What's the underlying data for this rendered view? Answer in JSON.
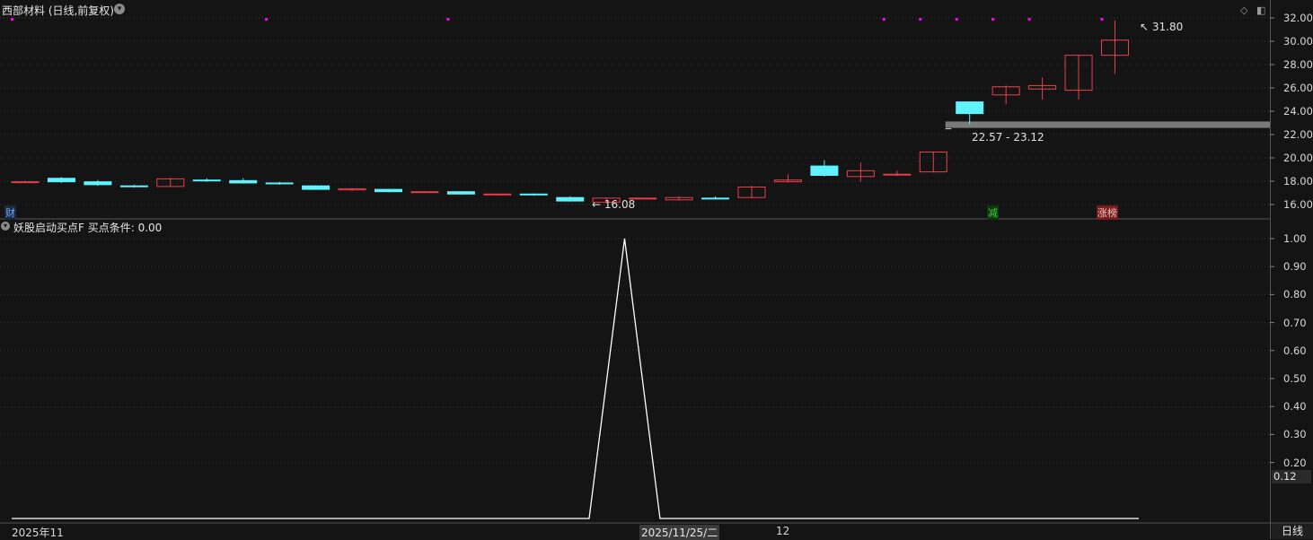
{
  "header": {
    "title": "西部材料 (日线,前复权)",
    "indicator_title": "妖股启动买点F  买点条件: 0.00"
  },
  "colors": {
    "background": "#141414",
    "up": "#e8404b",
    "down": "#5ef3ff",
    "marker": "#ff00ff",
    "indicator_line": "#ffffff",
    "grid": "#3a3a3a",
    "support_band": "#7a7a7a"
  },
  "price_axis": {
    "ticks": [
      "32.00",
      "30.00",
      "28.00",
      "26.00",
      "24.00",
      "22.00",
      "20.00",
      "18.00",
      "16.00"
    ]
  },
  "indicator_axis": {
    "ticks": [
      "1.00",
      "0.90",
      "0.80",
      "0.70",
      "0.60",
      "0.50",
      "0.40",
      "0.30",
      "0.20"
    ],
    "current_value": "0.12"
  },
  "time_axis": {
    "start_label": "2025年11",
    "cursor_label": "2025/11/25/二",
    "month_label": "12"
  },
  "bottom_right": {
    "period_label": "日线"
  },
  "tags": {
    "finance": "财",
    "reduce": "减",
    "limit_list": "涨榜"
  },
  "annotations": {
    "low_label": "16.08",
    "high_label": "31.80",
    "support_range": "22.57 - 23.12"
  },
  "chart_data": {
    "type": "candlestick",
    "price_range": [
      15.2,
      32.4
    ],
    "indicator_range": [
      0.0,
      1.0
    ],
    "candles": [
      {
        "o": 17.95,
        "h": 18.05,
        "l": 17.85,
        "c": 17.95
      },
      {
        "o": 18.25,
        "h": 18.35,
        "l": 17.85,
        "c": 17.95
      },
      {
        "o": 17.95,
        "h": 18.1,
        "l": 17.6,
        "c": 17.7
      },
      {
        "o": 17.6,
        "h": 17.7,
        "l": 17.45,
        "c": 17.55
      },
      {
        "o": 17.55,
        "h": 18.3,
        "l": 17.5,
        "c": 18.2
      },
      {
        "o": 18.1,
        "h": 18.25,
        "l": 17.95,
        "c": 18.05
      },
      {
        "o": 18.05,
        "h": 18.25,
        "l": 17.8,
        "c": 17.85
      },
      {
        "o": 17.85,
        "h": 17.95,
        "l": 17.7,
        "c": 17.8
      },
      {
        "o": 17.6,
        "h": 17.65,
        "l": 17.25,
        "c": 17.3
      },
      {
        "o": 17.25,
        "h": 17.4,
        "l": 17.15,
        "c": 17.35
      },
      {
        "o": 17.3,
        "h": 17.35,
        "l": 17.05,
        "c": 17.1
      },
      {
        "o": 17.1,
        "h": 17.15,
        "l": 17.05,
        "c": 17.1
      },
      {
        "o": 17.1,
        "h": 17.15,
        "l": 16.85,
        "c": 16.9
      },
      {
        "o": 16.9,
        "h": 16.95,
        "l": 16.8,
        "c": 16.9
      },
      {
        "o": 16.9,
        "h": 16.95,
        "l": 16.75,
        "c": 16.85
      },
      {
        "o": 16.6,
        "h": 16.7,
        "l": 16.25,
        "c": 16.3
      },
      {
        "o": 16.2,
        "h": 16.6,
        "l": 16.08,
        "c": 16.55
      },
      {
        "o": 16.5,
        "h": 16.6,
        "l": 16.45,
        "c": 16.55
      },
      {
        "o": 16.4,
        "h": 16.7,
        "l": 16.35,
        "c": 16.6
      },
      {
        "o": 16.55,
        "h": 16.7,
        "l": 16.45,
        "c": 16.5
      },
      {
        "o": 16.6,
        "h": 17.6,
        "l": 16.55,
        "c": 17.5
      },
      {
        "o": 17.95,
        "h": 18.6,
        "l": 17.9,
        "c": 18.1
      },
      {
        "o": 19.3,
        "h": 19.8,
        "l": 18.4,
        "c": 18.5
      },
      {
        "o": 18.4,
        "h": 19.6,
        "l": 17.95,
        "c": 18.9
      },
      {
        "o": 18.6,
        "h": 18.9,
        "l": 18.45,
        "c": 18.6
      },
      {
        "o": 18.8,
        "h": 20.5,
        "l": 18.75,
        "c": 20.5
      },
      {
        "o": 24.8,
        "h": 24.8,
        "l": 22.9,
        "c": 23.8
      },
      {
        "o": 25.4,
        "h": 26.2,
        "l": 24.6,
        "c": 26.1
      },
      {
        "o": 25.9,
        "h": 26.9,
        "l": 25.0,
        "c": 26.2
      },
      {
        "o": 25.8,
        "h": 28.8,
        "l": 25.0,
        "c": 28.8
      },
      {
        "o": 28.8,
        "h": 31.8,
        "l": 27.2,
        "c": 30.1
      }
    ],
    "marker_candles": [
      0,
      7,
      12,
      24,
      25,
      26,
      27,
      28,
      30
    ],
    "support_band": [
      22.57,
      23.12
    ],
    "indicator_values": [
      0,
      0,
      0,
      0,
      0,
      0,
      0,
      0,
      0,
      0,
      0,
      0,
      0,
      0,
      0,
      0,
      0,
      1,
      0,
      0,
      0,
      0,
      0,
      0,
      0,
      0,
      0,
      0,
      0,
      0,
      0,
      0
    ]
  }
}
